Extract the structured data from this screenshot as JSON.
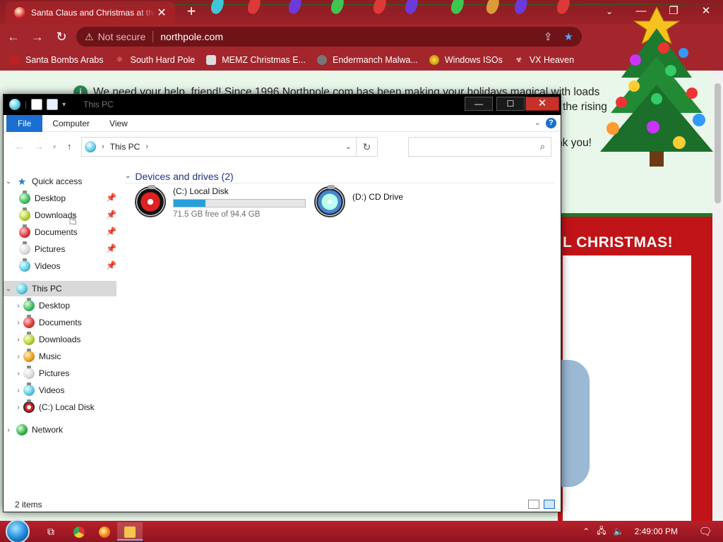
{
  "browser": {
    "tab_title": "Santa Claus and Christmas at the",
    "tab_close": "✕",
    "new_tab": "+",
    "address": {
      "security": "Not secure",
      "url": "northpole.com"
    },
    "bookmarks": [
      {
        "label": "Santa Bombs Arabs",
        "icon": "santa-icon"
      },
      {
        "label": "South Hard Pole",
        "icon": "snowflake-icon"
      },
      {
        "label": "MEMZ Christmas E...",
        "icon": "memz-icon"
      },
      {
        "label": "Endermanch Malwa...",
        "icon": "raccoon-icon"
      },
      {
        "label": "Windows ISOs",
        "icon": "ornament-icon"
      },
      {
        "label": "VX Heaven",
        "icon": "biohazard-icon"
      }
    ]
  },
  "webpage": {
    "notice_line1": "We need your help, friend! Since 1996 Northpole.com has been making your holidays magical with loads",
    "notice_line2": "the rising",
    "notice_line3": "nk you!",
    "banner": "L CHRISTMAS!"
  },
  "explorer": {
    "title": "This PC",
    "ribbon_tabs": [
      "File",
      "Computer",
      "View"
    ],
    "breadcrumb": "This PC",
    "search_placeholder": "",
    "nav": {
      "quick_access": "Quick access",
      "quick_items": [
        {
          "label": "Desktop",
          "icon": "green"
        },
        {
          "label": "Downloads",
          "icon": "lime"
        },
        {
          "label": "Documents",
          "icon": "red"
        },
        {
          "label": "Pictures",
          "icon": "white"
        },
        {
          "label": "Videos",
          "icon": "cyan"
        }
      ],
      "this_pc": "This PC",
      "pc_items": [
        {
          "label": "Desktop",
          "icon": "green"
        },
        {
          "label": "Documents",
          "icon": "red"
        },
        {
          "label": "Downloads",
          "icon": "lime"
        },
        {
          "label": "Music",
          "icon": "orange"
        },
        {
          "label": "Pictures",
          "icon": "white"
        },
        {
          "label": "Videos",
          "icon": "cyan"
        },
        {
          "label": "(C:) Local Disk",
          "icon": "disk"
        }
      ],
      "network": "Network"
    },
    "group_header": "Devices and drives (2)",
    "drives": [
      {
        "name": "(C:) Local Disk",
        "free_text": "71.5 GB free of 94.4 GB",
        "used_fraction": 0.243
      },
      {
        "name": "(D:) CD Drive"
      }
    ],
    "status": "2 items"
  },
  "taskbar": {
    "clock": "2:49:00 PM"
  },
  "colors": {
    "theme_red": "#a3262c",
    "explorer_accent": "#1a6fd0",
    "drive_bar": "#26a0da"
  }
}
